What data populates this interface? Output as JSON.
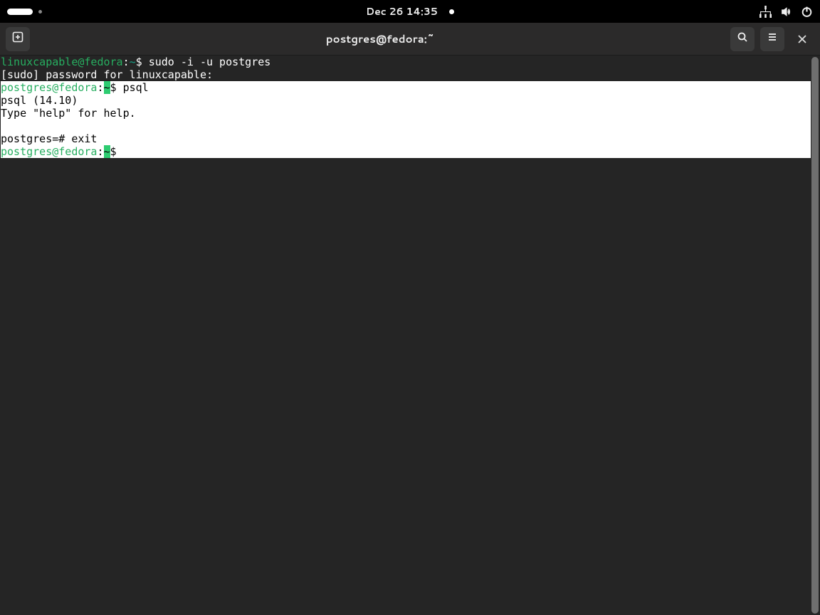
{
  "topbar": {
    "datetime": "Dec 26  14:35"
  },
  "window": {
    "title": "postgres@fedora:~"
  },
  "term": {
    "l1_user": "linuxcapable@fedora",
    "l1_sep": ":",
    "l1_tilde": "~",
    "l1_cmd": "$ sudo -i -u postgres",
    "l2": "[sudo] password for linuxcapable:",
    "l3_user": "postgres@fedora",
    "l3_sep": ":",
    "l3_tilde": "~",
    "l3_cmd": "$ psql",
    "l4": "psql (14.10)",
    "l5": "Type \"help\" for help.",
    "l6": "",
    "l7": "postgres=# exit",
    "l8_user": "postgres@fedora",
    "l8_sep": ":",
    "l8_tilde": "~",
    "l8_cmd": "$ "
  }
}
